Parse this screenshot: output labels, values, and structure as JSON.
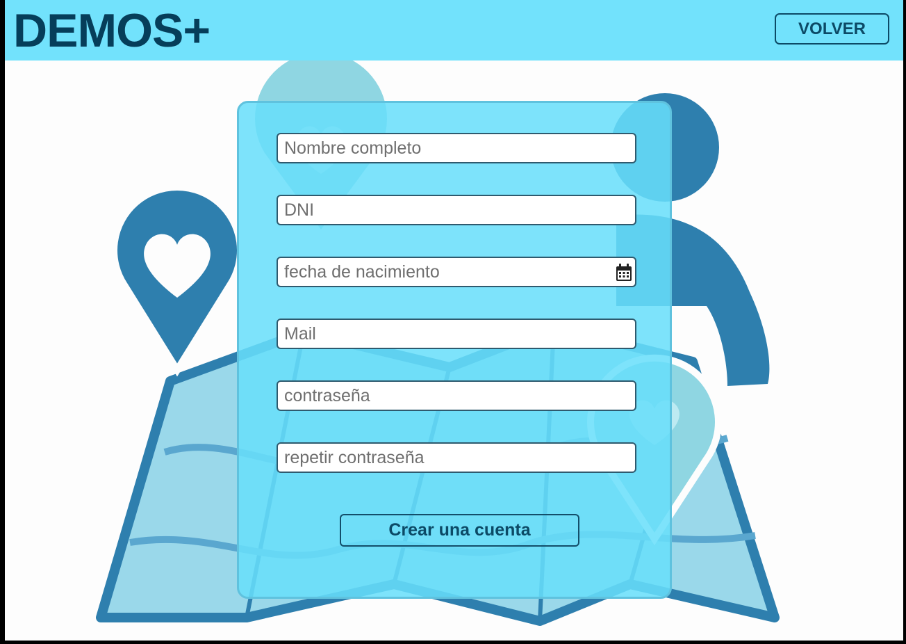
{
  "header": {
    "logo": "DEMOS+",
    "back_label": "VOLVER",
    "background_color": "#72e2fc"
  },
  "form": {
    "fields": [
      {
        "name": "full-name",
        "placeholder": "Nombre completo"
      },
      {
        "name": "dni",
        "placeholder": "DNI"
      },
      {
        "name": "birth-date",
        "placeholder": "fecha de nacimiento",
        "icon": "calendar-icon"
      },
      {
        "name": "mail",
        "placeholder": "Mail"
      },
      {
        "name": "password",
        "placeholder": "contraseña"
      },
      {
        "name": "repeat-password",
        "placeholder": "repetir contraseña"
      }
    ],
    "submit_label": "Crear una cuenta"
  },
  "illustration": {
    "primary_color": "#2e7fae",
    "light_color": "#9ad8ea",
    "icons": [
      "map-icon",
      "heart-pin-icon",
      "person-icon"
    ]
  }
}
